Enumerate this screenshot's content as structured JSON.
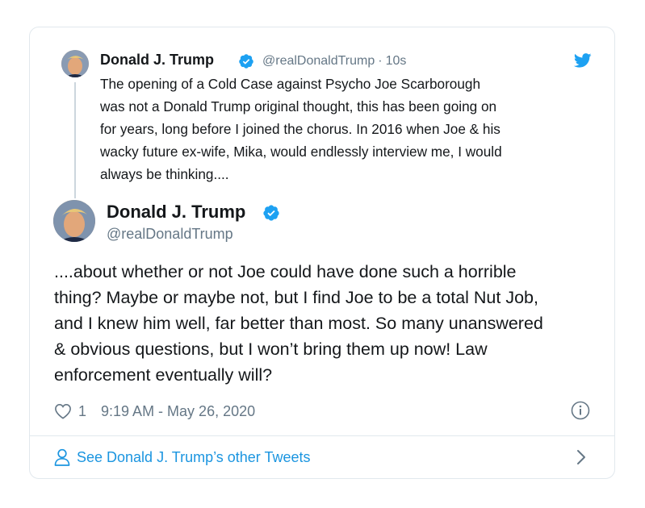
{
  "quoted": {
    "name": "Donald J. Trump",
    "handle": "@realDonaldTrump",
    "separator": "·",
    "time": "10s",
    "text": "The opening of a Cold Case against Psycho Joe Scarborough\nwas not a Donald Trump original thought, this has been going on\nfor years, long before I joined the chorus. In 2016 when Joe & his\nwacky future ex-wife, Mika, would endlessly interview me, I would\nalways be thinking...."
  },
  "main": {
    "name": "Donald J. Trump",
    "handle": "@realDonaldTrump",
    "text": "....about whether or not Joe could have done such a horrible\nthing? Maybe or maybe not, but I find Joe to be a total Nut Job,\nand I knew him well, far better than most. So many unanswered\n& obvious questions, but I won’t bring them up now! Law\nenforcement eventually will?",
    "likes": "1",
    "timestamp": "9:19 AM - May 26, 2020"
  },
  "footer": {
    "link_label": "See Donald J. Trump’s other Tweets"
  },
  "icons": {
    "verified": "verified-badge-icon",
    "brand": "twitter-bird-icon",
    "like": "heart-icon",
    "info": "info-icon",
    "profile": "person-icon",
    "more": "chevron-right-icon"
  },
  "colors": {
    "brand_blue": "#1da1f2",
    "link_blue": "#1b95e0",
    "secondary_text": "#657786",
    "primary_text": "#14171a",
    "border": "#e1e8ed"
  }
}
